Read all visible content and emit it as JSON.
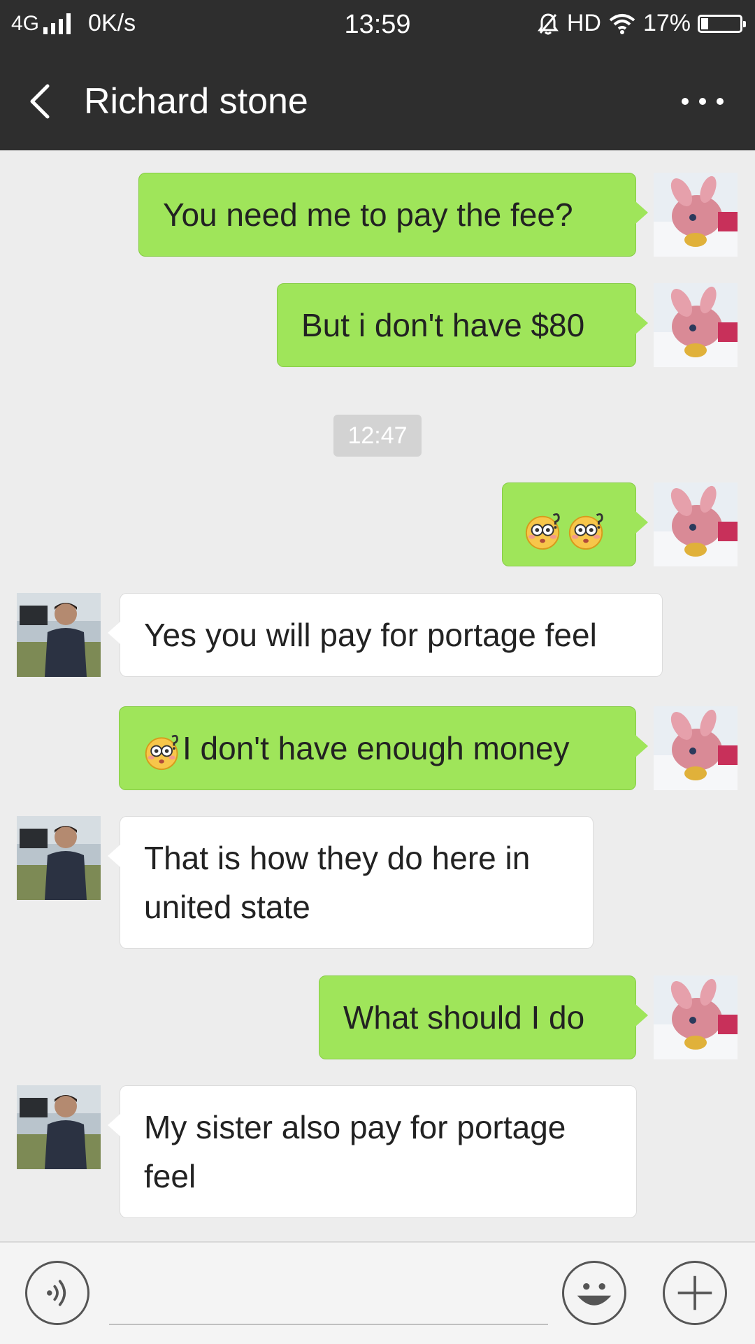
{
  "status_bar": {
    "network": "4G",
    "speed": "0K/s",
    "time": "13:59",
    "hd": "HD",
    "battery": "17%",
    "battery_level": 0.17
  },
  "header": {
    "title": "Richard stone",
    "back_icon": "chevron-left-icon",
    "more_icon": "more-dots-icon"
  },
  "colors": {
    "header_bg": "#2e2e2e",
    "my_bubble": "#9fe55a",
    "their_bubble": "#ffffff",
    "chat_bg": "#ededed"
  },
  "messages": [
    {
      "from": "me",
      "text": "You need me to pay the fee?"
    },
    {
      "from": "me",
      "text": "But i don't have $80"
    },
    {
      "type": "timestamp",
      "text": "12:47"
    },
    {
      "from": "me",
      "emoji": [
        "dizzy-face-emoji",
        "dizzy-face-emoji"
      ],
      "text": ""
    },
    {
      "from": "them",
      "text": "Yes you will pay for portage feel"
    },
    {
      "from": "me",
      "emoji": [
        "dizzy-face-emoji"
      ],
      "text": "I don't have enough money"
    },
    {
      "from": "them",
      "text": "That is how they do here in united state"
    },
    {
      "from": "me",
      "text": "What should I do"
    },
    {
      "from": "them",
      "text": "My sister also pay for portage feel"
    }
  ],
  "input_bar": {
    "placeholder": "",
    "voice_icon": "voice-icon",
    "emoji_icon": "smiley-icon",
    "plus_icon": "plus-icon"
  }
}
